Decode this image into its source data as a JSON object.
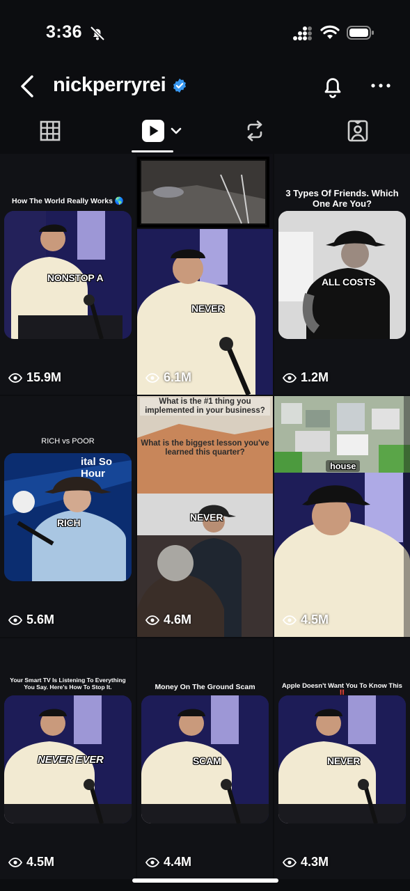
{
  "status_bar": {
    "time": "3:36"
  },
  "header": {
    "username": "nickperryrei"
  },
  "tabs": [
    {
      "name": "grid",
      "active": false
    },
    {
      "name": "reels",
      "active": true
    },
    {
      "name": "reposts",
      "active": false
    },
    {
      "name": "tagged",
      "active": false
    }
  ],
  "posts": [
    {
      "caption": "How The World Really Works 🌎",
      "overlay": "NONSTOP A",
      "views": "15.9M"
    },
    {
      "caption": "",
      "overlay": "NEVER",
      "views": "6.1M"
    },
    {
      "caption": "3 Types Of Friends. Which One Are You?",
      "overlay": "ALL COSTS",
      "views": "1.2M"
    },
    {
      "caption": "RICH vs POOR",
      "overlay": "RICH",
      "views": "5.6M",
      "screen_text": "ital So Hour"
    },
    {
      "caption": "What is the #1 thing you implemented in your business?",
      "caption2": "What is the biggest lesson you've learned this quarter?",
      "overlay": "NEVER",
      "views": "4.6M"
    },
    {
      "caption": "house",
      "overlay": "",
      "views": "4.5M"
    },
    {
      "caption": "Your Smart TV Is Listening To Everything You Say. Here's How To Stop It.",
      "overlay": "NEVER EVER",
      "views": "4.5M"
    },
    {
      "caption": "Money On The Ground Scam",
      "overlay": "SCAM",
      "views": "4.4M"
    },
    {
      "caption": "Apple Doesn't Want You To Know This ‼️",
      "overlay": "NEVER",
      "views": "4.3M"
    }
  ],
  "colors": {
    "background": "#0c0d10",
    "verified": "#3897f0",
    "hoodie": "#f2ead2",
    "studio_blue": "#1c1a55"
  }
}
